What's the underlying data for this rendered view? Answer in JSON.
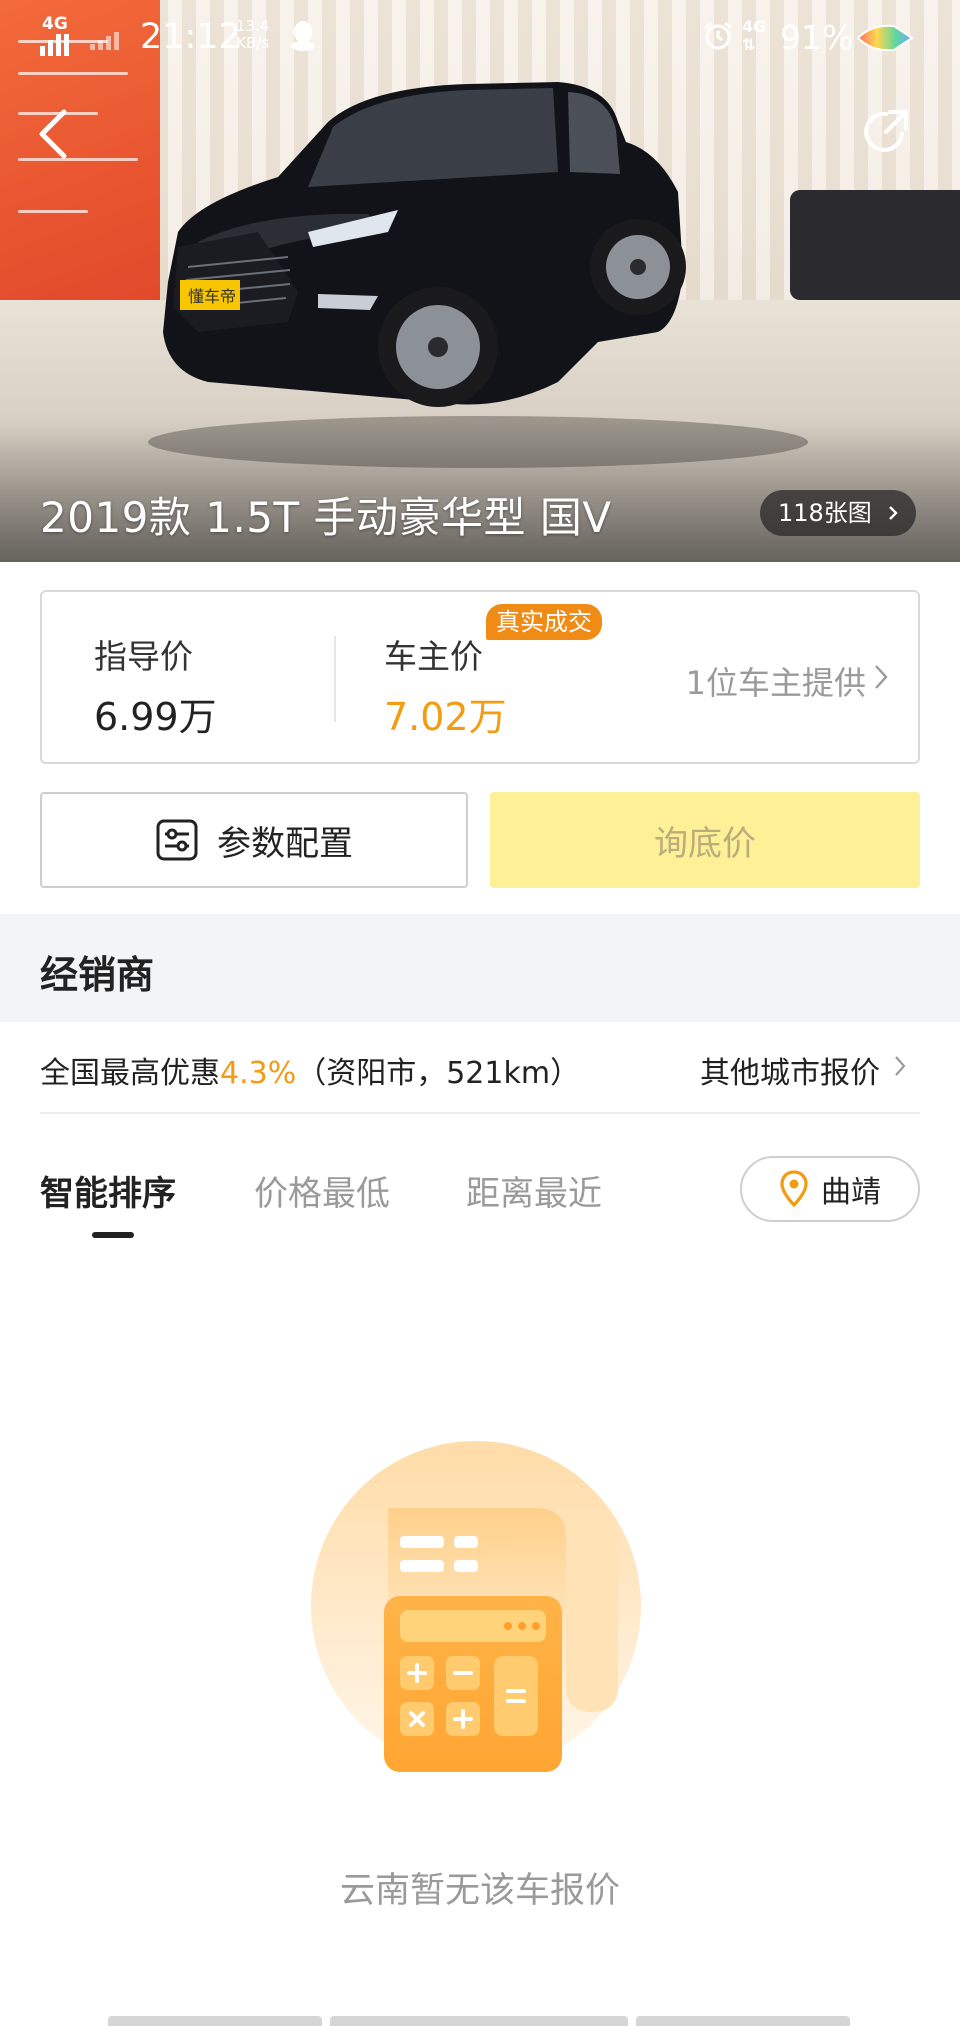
{
  "status_bar": {
    "network_left": "4G",
    "time": "21:12",
    "speed_value": "13.4",
    "speed_unit": "KB/s",
    "network_right": "4G",
    "battery": "91%"
  },
  "hero": {
    "title": "2019款 1.5T 手动豪华型 国V",
    "photo_count": "118张图"
  },
  "price_card": {
    "guide_label": "指导价",
    "guide_value": "6.99万",
    "owner_label": "车主价",
    "owner_value": "7.02万",
    "deal_badge": "真实成交",
    "provider": "1位车主提供",
    "accent_color": "#f39c12"
  },
  "actions": {
    "config_label": "参数配置",
    "inquiry_label": "询底价",
    "inquiry_color": "#fdf097"
  },
  "dealer": {
    "section_title": "经销商",
    "discount_prefix": "全国最高优惠",
    "discount_pct": "4.3%",
    "discount_suffix": "（资阳市，521km）",
    "other_cities": "其他城市报价"
  },
  "sort_tabs": [
    {
      "label": "智能排序",
      "active": true
    },
    {
      "label": "价格最低",
      "active": false
    },
    {
      "label": "距离最近",
      "active": false
    }
  ],
  "city_selector": {
    "city": "曲靖",
    "icon": "location-pin-icon"
  },
  "empty_state": {
    "icon": "calculator-receipt-icon",
    "message": "云南暂无该车报价"
  }
}
